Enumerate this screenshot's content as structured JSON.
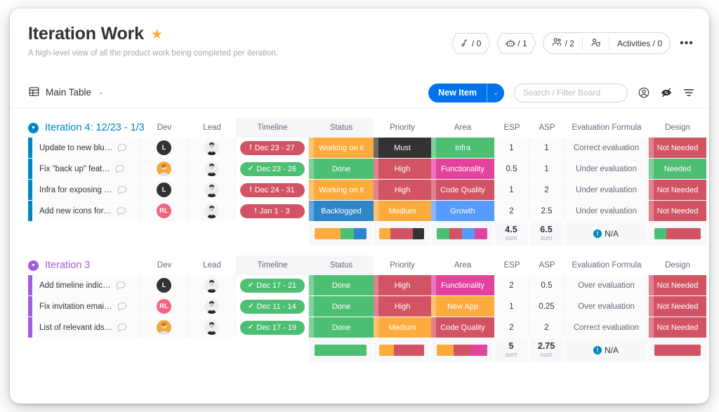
{
  "header": {
    "title": "Iteration Work",
    "star_icon": "star-icon",
    "description": "A high-level view of all the product work being completed per iteration.",
    "badges": [
      {
        "icon": "automation-magic-icon",
        "label": "/ 0"
      },
      {
        "icon": "robot-integration-icon",
        "label": "/ 1"
      }
    ],
    "people_pill": {
      "icon": "people-icon",
      "label": "/ 2"
    },
    "invite_icon": "invite-lock-icon",
    "activities_label": "Activities / 0",
    "more_label": "•••"
  },
  "toolbar": {
    "view_icon": "table-icon",
    "view_label": "Main Table",
    "view_caret": "⌄",
    "new_item_label": "New Item",
    "new_item_caret": "⌄",
    "search_placeholder": "Search / Filter Board",
    "person_icon": "person-circle-icon",
    "hide_icon": "eye-slash-icon",
    "filter_icon": "filter-icon"
  },
  "columns": [
    "Dev",
    "Lead",
    "Timeline",
    "Status",
    "Priority",
    "Area",
    "ESP",
    "ASP",
    "Evaluation Formula",
    "Design"
  ],
  "colors": {
    "accent_blue": "#0073ea",
    "group1": "#0086c0",
    "group2": "#a25ddc",
    "orange": "#fdab3d",
    "green": "#00c875",
    "green_soft": "#5ec07d",
    "red": "#d25464",
    "dark": "#333333",
    "blue": "#1f76c2",
    "blue_light": "#579bfc",
    "pink": "#e2view",
    "magenta": "#e2449d",
    "pink_avatar": "#f1657f"
  },
  "groups": [
    {
      "title": "Iteration 4: 12/23 - 1/3",
      "color": "#0086c0",
      "collapse_icon": "chevron-down-circle-icon",
      "rows": [
        {
          "name": "Update to new blu…",
          "comment_icon": "comment-bubble-icon",
          "dev": {
            "initials": "L",
            "bg": "#333333",
            "type": "initials"
          },
          "lead": {
            "type": "photo",
            "bg": "#e9eaee"
          },
          "timeline": {
            "label": "Dec 23 - 27",
            "icon": "!",
            "bg": "#d25464"
          },
          "status": {
            "label": "Working on it",
            "bg": "#fdab3d"
          },
          "priority": {
            "label": "Must",
            "bg": "#333333"
          },
          "area": {
            "label": "Infra",
            "bg": "#4cbf72"
          },
          "esp": "1",
          "asp": "1",
          "evaluation": "Correct evaluation",
          "design": {
            "label": "Not Needed",
            "bg": "#d25464"
          }
        },
        {
          "name": "Fix \"back up\" feat…",
          "comment_icon": "comment-bubble-icon",
          "dev": {
            "type": "photo",
            "bg": "#f5a623"
          },
          "lead": {
            "type": "photo",
            "bg": "#e9eaee"
          },
          "timeline": {
            "label": "Dec 23 - 26",
            "icon": "✓",
            "bg": "#4cbf72"
          },
          "status": {
            "label": "Done",
            "bg": "#4cbf72"
          },
          "priority": {
            "label": "High",
            "bg": "#d25464"
          },
          "area": {
            "label": "Functionality",
            "bg": "#e2449d"
          },
          "esp": "0.5",
          "asp": "1",
          "evaluation": "Under evaluation",
          "design": {
            "label": "Needed",
            "bg": "#4cbf72"
          }
        },
        {
          "name": "Infra for exposing …",
          "comment_icon": "comment-bubble-icon",
          "dev": {
            "initials": "L",
            "bg": "#333333",
            "type": "initials"
          },
          "lead": {
            "type": "photo",
            "bg": "#e9eaee"
          },
          "timeline": {
            "label": "Dec 24 - 31",
            "icon": "!",
            "bg": "#d25464"
          },
          "status": {
            "label": "Working on it",
            "bg": "#fdab3d"
          },
          "priority": {
            "label": "High",
            "bg": "#d25464"
          },
          "area": {
            "label": "Code Quality",
            "bg": "#d25464"
          },
          "esp": "1",
          "asp": "2",
          "evaluation": "Under evaluation",
          "design": {
            "label": "Not Needed",
            "bg": "#d25464"
          }
        },
        {
          "name": "Add new icons for…",
          "comment_icon": "comment-bubble-icon",
          "dev": {
            "initials": "RL",
            "bg": "#f1657f",
            "type": "initials"
          },
          "lead": {
            "type": "photo",
            "bg": "#e9eaee"
          },
          "timeline": {
            "label": "Jan 1 - 3",
            "icon": "!",
            "bg": "#d25464"
          },
          "status": {
            "label": "Backlogged",
            "bg": "#2e86c8"
          },
          "priority": {
            "label": "Medium",
            "bg": "#fdab3d"
          },
          "area": {
            "label": "Growth",
            "bg": "#579bfc"
          },
          "esp": "2",
          "asp": "2.5",
          "evaluation": "Under evaluation",
          "design": {
            "label": "Not Needed",
            "bg": "#d25464"
          }
        }
      ],
      "summary": {
        "status_segments": [
          {
            "bg": "#fdab3d",
            "pct": 50
          },
          {
            "bg": "#4cbf72",
            "pct": 25
          },
          {
            "bg": "#2e86c8",
            "pct": 25
          }
        ],
        "priority_segments": [
          {
            "bg": "#fdab3d",
            "pct": 25
          },
          {
            "bg": "#d25464",
            "pct": 50
          },
          {
            "bg": "#333333",
            "pct": 25
          }
        ],
        "area_segments": [
          {
            "bg": "#4cbf72",
            "pct": 25
          },
          {
            "bg": "#d25464",
            "pct": 25
          },
          {
            "bg": "#579bfc",
            "pct": 25
          },
          {
            "bg": "#e2449d",
            "pct": 25
          }
        ],
        "esp": {
          "value": "4.5",
          "label": "sum"
        },
        "asp": {
          "value": "6.5",
          "label": "sum"
        },
        "evaluation": {
          "value": "N/A",
          "icon": "info-icon"
        },
        "design_segments": [
          {
            "bg": "#4cbf72",
            "pct": 25
          },
          {
            "bg": "#d25464",
            "pct": 75
          }
        ]
      }
    },
    {
      "title": "Iteration 3",
      "color": "#a25ddc",
      "collapse_icon": "chevron-down-circle-icon",
      "rows": [
        {
          "name": "Add timeline indic…",
          "comment_icon": "comment-bubble-icon",
          "dev": {
            "initials": "L",
            "bg": "#333333",
            "type": "initials"
          },
          "lead": {
            "type": "photo",
            "bg": "#e9eaee"
          },
          "timeline": {
            "label": "Dec 17 - 21",
            "icon": "✓",
            "bg": "#4cbf72"
          },
          "status": {
            "label": "Done",
            "bg": "#4cbf72"
          },
          "priority": {
            "label": "High",
            "bg": "#d25464"
          },
          "area": {
            "label": "Functionality",
            "bg": "#e2449d"
          },
          "esp": "2",
          "asp": "0.5",
          "evaluation": "Over evaluation",
          "design": {
            "label": "Not Needed",
            "bg": "#d25464"
          }
        },
        {
          "name": "Fix invitation emai…",
          "comment_icon": "comment-bubble-icon",
          "dev": {
            "initials": "RL",
            "bg": "#f1657f",
            "type": "initials"
          },
          "lead": {
            "type": "photo",
            "bg": "#e9eaee"
          },
          "timeline": {
            "label": "Dec 11 - 14",
            "icon": "✓",
            "bg": "#4cbf72"
          },
          "status": {
            "label": "Done",
            "bg": "#4cbf72"
          },
          "priority": {
            "label": "High",
            "bg": "#d25464"
          },
          "area": {
            "label": "New App",
            "bg": "#fdab3d"
          },
          "esp": "1",
          "asp": "0.25",
          "evaluation": "Over evaluation",
          "design": {
            "label": "Not Needed",
            "bg": "#d25464"
          }
        },
        {
          "name": "List of relevant ids…",
          "comment_icon": "comment-bubble-icon",
          "dev": {
            "type": "photo",
            "bg": "#f5a623"
          },
          "lead": {
            "type": "photo",
            "bg": "#e9eaee"
          },
          "timeline": {
            "label": "Dec 17 - 19",
            "icon": "✓",
            "bg": "#4cbf72"
          },
          "status": {
            "label": "Done",
            "bg": "#4cbf72"
          },
          "priority": {
            "label": "Medium",
            "bg": "#fdab3d"
          },
          "area": {
            "label": "Code Quality",
            "bg": "#d25464"
          },
          "esp": "2",
          "asp": "2",
          "evaluation": "Correct evaluation",
          "design": {
            "label": "Not Needed",
            "bg": "#d25464"
          }
        }
      ],
      "summary": {
        "status_segments": [
          {
            "bg": "#4cbf72",
            "pct": 100
          }
        ],
        "priority_segments": [
          {
            "bg": "#fdab3d",
            "pct": 33
          },
          {
            "bg": "#d25464",
            "pct": 67
          }
        ],
        "area_segments": [
          {
            "bg": "#fdab3d",
            "pct": 33
          },
          {
            "bg": "#d25464",
            "pct": 34
          },
          {
            "bg": "#e2449d",
            "pct": 33
          }
        ],
        "esp": {
          "value": "5",
          "label": "sum"
        },
        "asp": {
          "value": "2.75",
          "label": "sum"
        },
        "evaluation": {
          "value": "N/A",
          "icon": "info-icon"
        },
        "design_segments": [
          {
            "bg": "#d25464",
            "pct": 100
          }
        ]
      }
    }
  ]
}
